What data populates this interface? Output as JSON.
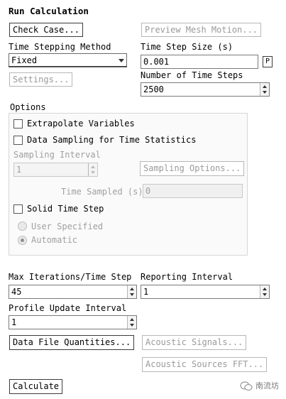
{
  "title": "Run Calculation",
  "check_case": "Check Case...",
  "preview_mesh_motion": "Preview Mesh Motion...",
  "time_stepping": {
    "label": "Time Stepping Method",
    "value": "Fixed"
  },
  "settings_button": "Settings...",
  "time_step_size": {
    "label": "Time Step Size (s)",
    "value": "0.001",
    "param_button": "P"
  },
  "number_of_time_steps": {
    "label": "Number of Time Steps",
    "value": "2500"
  },
  "options": {
    "label": "Options",
    "extrapolate_variables": {
      "label": "Extrapolate Variables",
      "checked": false
    },
    "data_sampling": {
      "label": "Data Sampling for Time Statistics",
      "checked": false
    },
    "sampling_interval": {
      "label": "Sampling Interval",
      "value": "1"
    },
    "sampling_options_button": "Sampling Options...",
    "time_sampled": {
      "label": "Time Sampled (s)",
      "value": "0"
    },
    "solid_time_step": {
      "label": "Solid Time Step",
      "checked": false
    },
    "user_specified": {
      "label": "User Specified",
      "selected": false
    },
    "automatic": {
      "label": "Automatic",
      "selected": true
    }
  },
  "max_iterations": {
    "label": "Max Iterations/Time Step",
    "value": "45"
  },
  "reporting_interval": {
    "label": "Reporting Interval",
    "value": "1"
  },
  "profile_update_interval": {
    "label": "Profile Update Interval",
    "value": "1"
  },
  "data_file_quantities": "Data File Quantities...",
  "acoustic_signals": "Acoustic Signals...",
  "acoustic_sources_fft": "Acoustic Sources FFT...",
  "calculate": "Calculate",
  "watermark": "南流坊"
}
